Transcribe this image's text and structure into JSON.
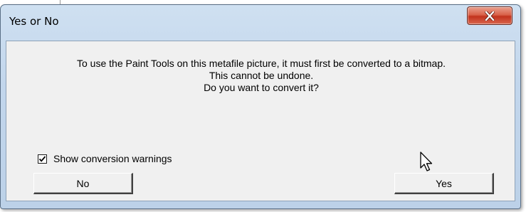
{
  "dialog": {
    "title": "Yes or No",
    "close_icon": "close-x-icon",
    "message_lines": [
      "To use the Paint Tools on this metafile picture, it must first be converted to a bitmap.",
      "This cannot be undone.",
      "Do you want to convert it?"
    ],
    "checkbox": {
      "label": "Show conversion warnings",
      "checked": true
    },
    "buttons": {
      "no_label": "No",
      "yes_label": "Yes"
    },
    "cursor_icon": "arrow-pointer-icon"
  },
  "colors": {
    "close_button": "#c2321d",
    "titlebar": "#c2d6ec",
    "client_background": "#f0f0f0"
  }
}
